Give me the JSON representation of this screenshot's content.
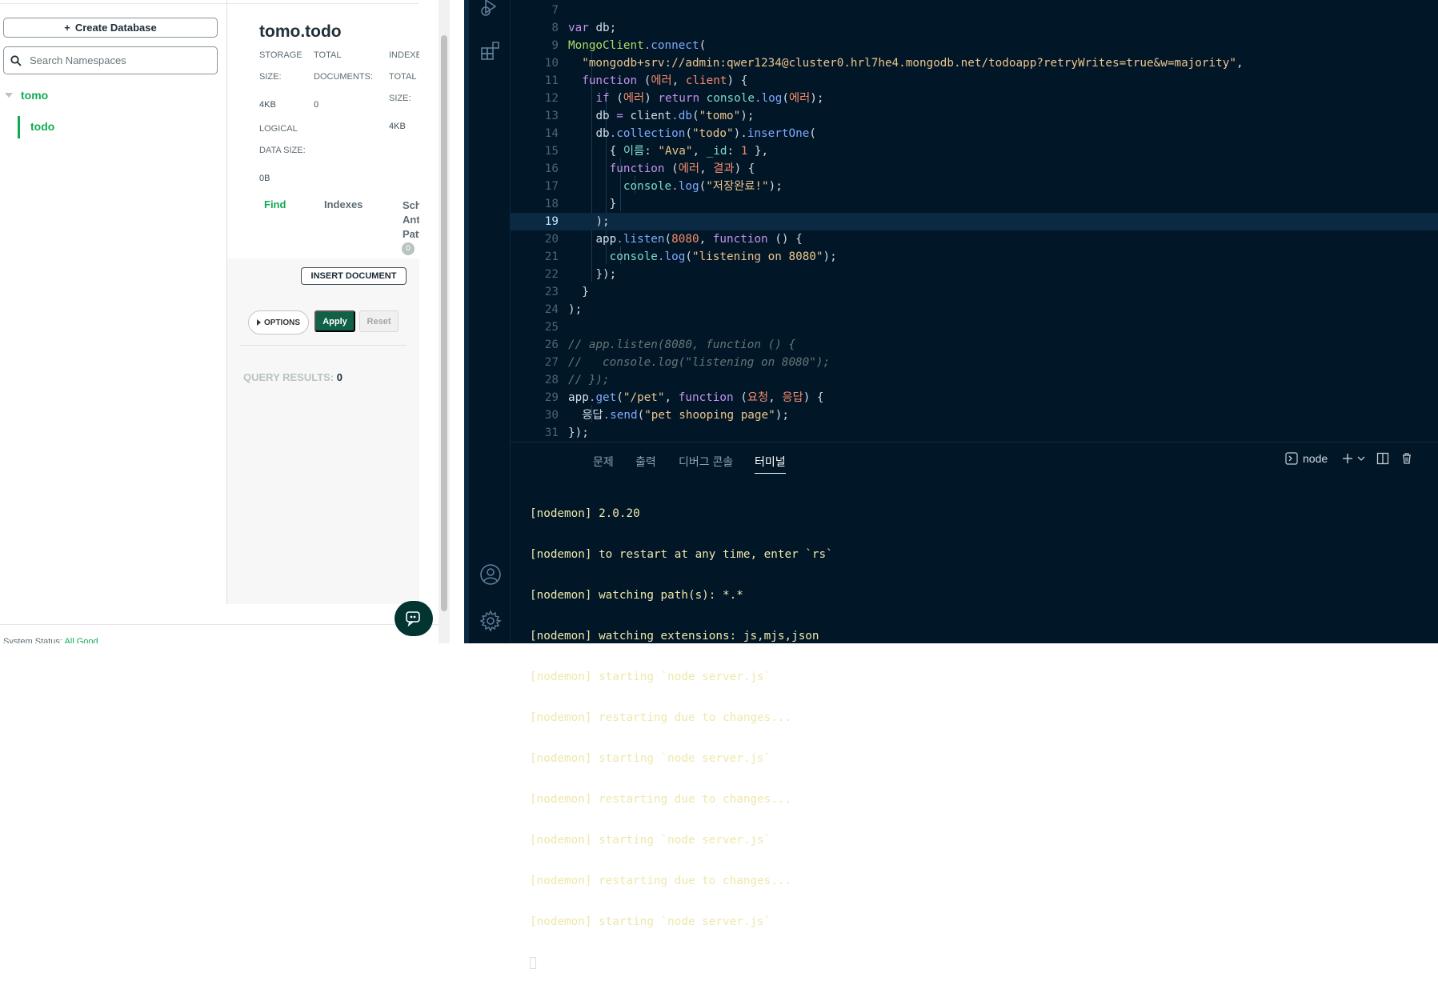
{
  "atlas": {
    "nav": {
      "create_button": "Create Database",
      "search_placeholder": "Search Namespaces",
      "database": "tomo",
      "collection": "todo"
    },
    "detail": {
      "title": "tomo.todo",
      "storage_label_1": "STORAGE",
      "storage_label_2": "SIZE:",
      "storage_value": "4KB",
      "logical_label_1": "LOGICAL",
      "logical_label_2": "DATA SIZE:",
      "logical_value": "0B",
      "docs_label_1": "TOTAL",
      "docs_label_2": "DOCUMENTS:",
      "docs_value": "0",
      "indexes_label_1": "INDEXES",
      "indexes_label_2": "TOTAL",
      "indexes_label_3": "SIZE:",
      "indexes_value": "4KB",
      "tabs": {
        "find": "Find",
        "indexes": "Indexes",
        "schema_1": "Schema",
        "schema_2": "Anti-",
        "schema_3": "Patterns",
        "schema_badge": "0"
      },
      "insert_button": "INSERT DOCUMENT",
      "options_button": "OPTIONS",
      "apply_button": "Apply",
      "reset_button": "Reset",
      "query_results_label": "QUERY RESULTS:",
      "query_results_value": "0"
    },
    "status": {
      "label": "System Status:",
      "value": "All Good"
    }
  },
  "vscode": {
    "code": {
      "l7": "7",
      "l8": "8",
      "l8_var": "var",
      "l8_db": "db",
      "l8_semi": ";",
      "l9": "9",
      "l9_client": "MongoClient",
      "l9_dot": ".",
      "l9_connect": "connect",
      "l9_paren": "(",
      "l10": "10",
      "l10_str": "\"mongodb+srv://admin:qwer1234@cluster0.hrl7he4.mongodb.net/todoapp?retryWrites=true&w=majority\"",
      "l10_comma": ",",
      "l11": "11",
      "l11_fn": "function",
      "l11_open": " (",
      "l11_err": "에러",
      "l11_comma": ", ",
      "l11_client": "client",
      "l11_close": ") {",
      "l12": "12",
      "l12_if": "if",
      "l12_open": " (",
      "l12_err": "에러",
      "l12_close": ") ",
      "l12_return": "return",
      "l12_console": " console",
      "l12_dot": ".",
      "l12_log": "log",
      "l12_p1": "(",
      "l12_err2": "에러",
      "l12_p2": ");",
      "l13": "13",
      "l13_db": "db",
      "l13_eq": " = ",
      "l13_client": "client",
      "l13_dot": ".",
      "l13_fn": "db",
      "l13_p1": "(",
      "l13_str": "\"tomo\"",
      "l13_p2": ");",
      "l14": "14",
      "l14_db": "db",
      "l14_dot": ".",
      "l14_coll": "collection",
      "l14_p1": "(",
      "l14_str": "\"todo\"",
      "l14_p2": ").",
      "l14_insert": "insertOne",
      "l14_p3": "(",
      "l15": "15",
      "l15_open": "{ ",
      "l15_key": "이름",
      "l15_colon": ": ",
      "l15_str": "\"Ava\"",
      "l15_comma": ", ",
      "l15_id": "_id",
      "l15_colon2": ": ",
      "l15_num": "1",
      "l15_close": " },",
      "l16": "16",
      "l16_fn": "function",
      "l16_open": " (",
      "l16_err": "에러",
      "l16_comma": ", ",
      "l16_res": "결과",
      "l16_close": ") {",
      "l17": "17",
      "l17_console": "console",
      "l17_dot": ".",
      "l17_log": "log",
      "l17_p1": "(",
      "l17_str": "\"저장완료!\"",
      "l17_p2": ");",
      "l18": "18",
      "l18_brace": "}",
      "l19": "19",
      "l19_close": ");",
      "l20": "20",
      "l20_app": "app",
      "l20_dot": ".",
      "l20_listen": "listen",
      "l20_p1": "(",
      "l20_num": "8080",
      "l20_comma": ", ",
      "l20_fn": "function",
      "l20_close": " () {",
      "l21": "21",
      "l21_console": "console",
      "l21_dot": ".",
      "l21_log": "log",
      "l21_p1": "(",
      "l21_str": "\"listening on 8080\"",
      "l21_p2": ");",
      "l22": "22",
      "l22_close": "});",
      "l23": "23",
      "l23_brace": "}",
      "l24": "24",
      "l24_close": ");",
      "l25": "25",
      "l26": "26",
      "l26_comment": "// app.listen(8080, function () {",
      "l27": "27",
      "l27_comment": "//   console.log(\"listening on 8080\");",
      "l28": "28",
      "l28_comment": "// });",
      "l29": "29",
      "l29_app": "app",
      "l29_dot": ".",
      "l29_get": "get",
      "l29_p1": "(",
      "l29_str": "\"/pet\"",
      "l29_comma": ", ",
      "l29_fn": "function",
      "l29_open": " (",
      "l29_req": "요청",
      "l29_comma2": ", ",
      "l29_res": "응답",
      "l29_close": ") {",
      "l30": "30",
      "l30_res": "응답",
      "l30_dot": ".",
      "l30_send": "send",
      "l30_p1": "(",
      "l30_str": "\"pet shooping page\"",
      "l30_p2": ");",
      "l31": "31",
      "l31_close": "});"
    },
    "panel": {
      "tab_problems": "문제",
      "tab_output": "출력",
      "tab_debug": "디버그 콘솔",
      "tab_terminal": "터미널",
      "terminal_name": "node",
      "lines": [
        "[nodemon] 2.0.20",
        "[nodemon] to restart at any time, enter `rs`",
        "[nodemon] watching path(s): *.*",
        "[nodemon] watching extensions: js,mjs,json",
        "[nodemon] starting `node server.js`",
        "[nodemon] restarting due to changes...",
        "[nodemon] starting `node server.js`",
        "[nodemon] restarting due to changes...",
        "[nodemon] starting `node server.js`",
        "[nodemon] restarting due to changes...",
        "[nodemon] starting `node server.js`"
      ]
    }
  }
}
